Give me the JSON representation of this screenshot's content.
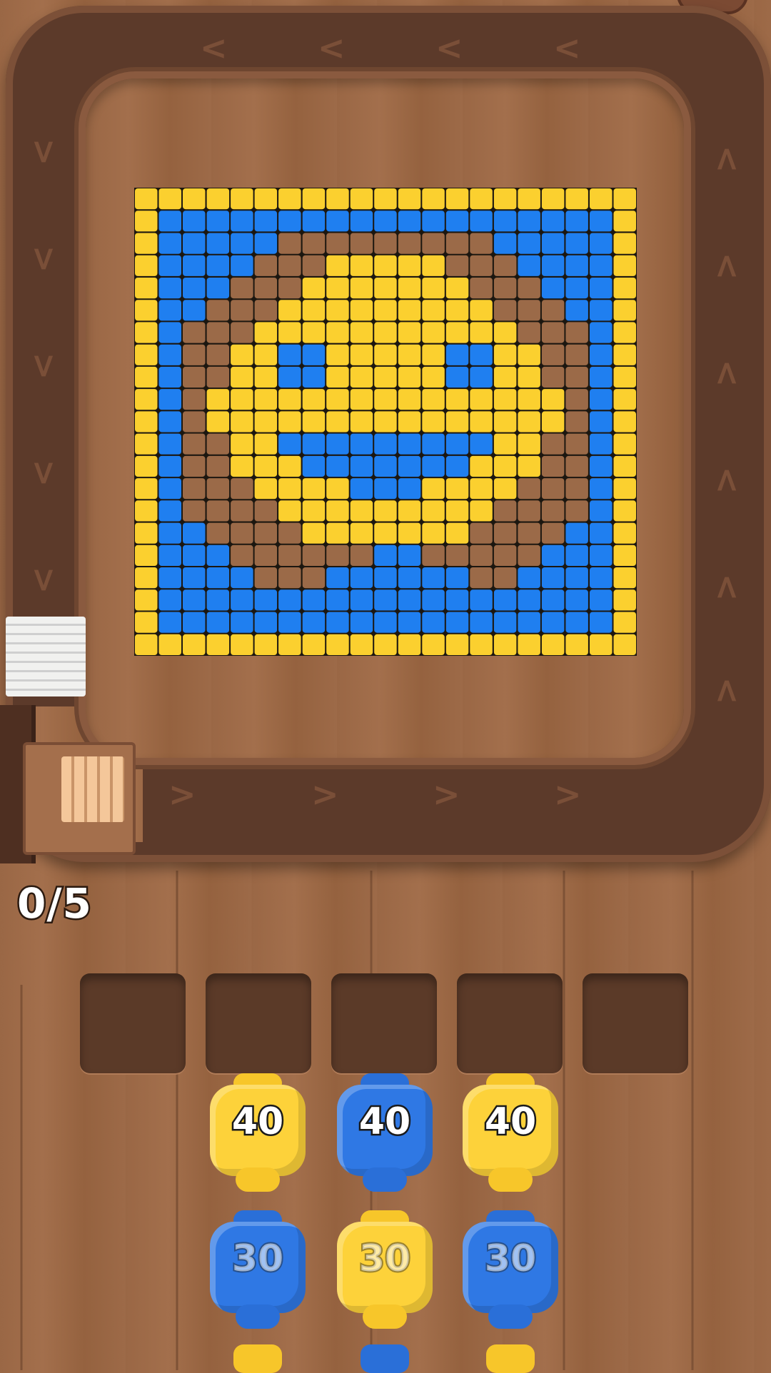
{
  "hud": {
    "counter": "0/5"
  },
  "board": {
    "grid": [
      "YYYYYYYYYYYYYYYYYYYYY",
      "YBBBBBBBBBBBBBBBBBBBY",
      "YBBBBB.........BBBBBY",
      "YBBBB...YYYYY...BBBBY",
      "YBBB...YYYYYYY...BBBY",
      "YBB...YYYYYYYYY...BBY",
      "YB...YYYYYYYYYYY...BY",
      "YB..YYBBYYYYYBBYY..BY",
      "YB..YYBBYYYYYBBYY..BY",
      "YB.YYYYYYYYYYYYYYY.BY",
      "YB.YYYYYYYYYYYYYYY.BY",
      "YB..YYBBBBBBBBBYY..BY",
      "YB..YYYBBBBBBBYYY..BY",
      "YB...YYYYBBBYYYY...BY",
      "YB....YYYYYYYYY....BY",
      "YBB....YYYYYYY....BBY",
      "YBBB......BB.....BBBY",
      "YBBBB...BBBBBB..BBBBY",
      "YBBBBBBBBBBBBBBBBBBBY",
      "YBBBBBBBBBBBBBBBBBBBY",
      "YYYYYYYYYYYYYYYYYYYYY"
    ],
    "colors": {
      "Y": "#fbd02f",
      "B": "#1f7ff0",
      "empty": "#9b6a48"
    }
  },
  "slots": [
    {
      "state": "empty"
    },
    {
      "state": "empty"
    },
    {
      "state": "empty"
    },
    {
      "state": "empty"
    },
    {
      "state": "empty"
    }
  ],
  "spools": [
    {
      "color": "yellow",
      "count": "40",
      "active": true
    },
    {
      "color": "blue",
      "count": "40",
      "active": true
    },
    {
      "color": "yellow",
      "count": "40",
      "active": true
    },
    {
      "color": "blue",
      "count": "30",
      "active": false
    },
    {
      "color": "yellow",
      "count": "30",
      "active": false
    },
    {
      "color": "blue",
      "count": "30",
      "active": false
    }
  ],
  "conveyor": {
    "arrow_icon": "chevron-icon"
  }
}
